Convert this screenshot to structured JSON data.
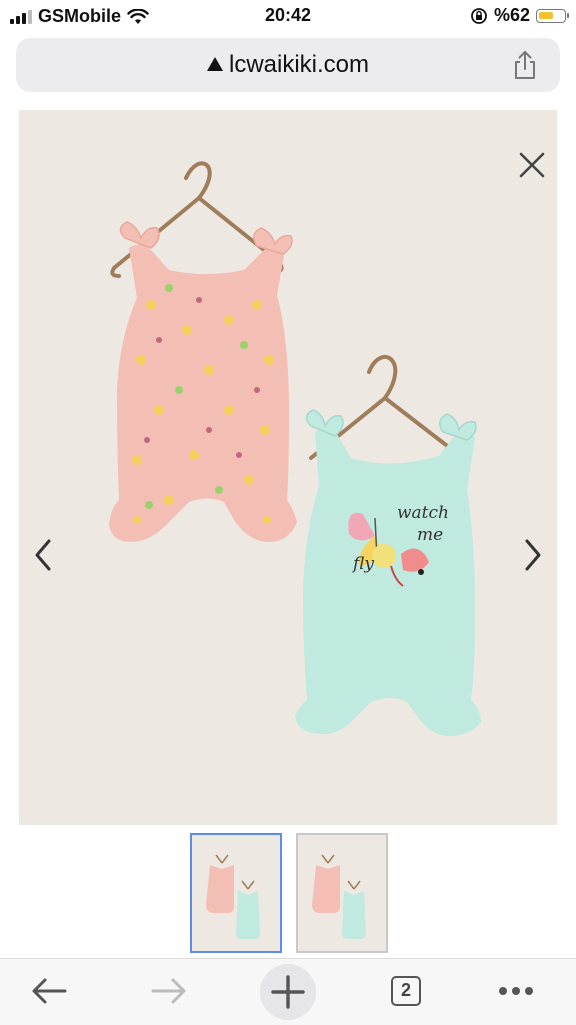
{
  "status_bar": {
    "carrier": "GSMobile",
    "time": "20:42",
    "battery_text": "%62",
    "battery_level": 0.62
  },
  "browser": {
    "url": "lcwaikiki.com",
    "tab_count": "2"
  },
  "product": {
    "print_text_line1": "watch",
    "print_text_line2": "me",
    "print_text_line3": "fly",
    "colors": {
      "pink_romper": "#f2bdb4",
      "mint_romper": "#bfe8df",
      "background": "#ede9e2"
    },
    "thumbnail_count": 2,
    "active_thumbnail": 1
  },
  "icons": [
    "wifi-icon",
    "lock-rotation-icon",
    "warning-icon",
    "share-icon",
    "close-icon",
    "chevron-left-icon",
    "chevron-right-icon",
    "back-icon",
    "forward-icon",
    "new-tab-icon",
    "more-icon"
  ]
}
